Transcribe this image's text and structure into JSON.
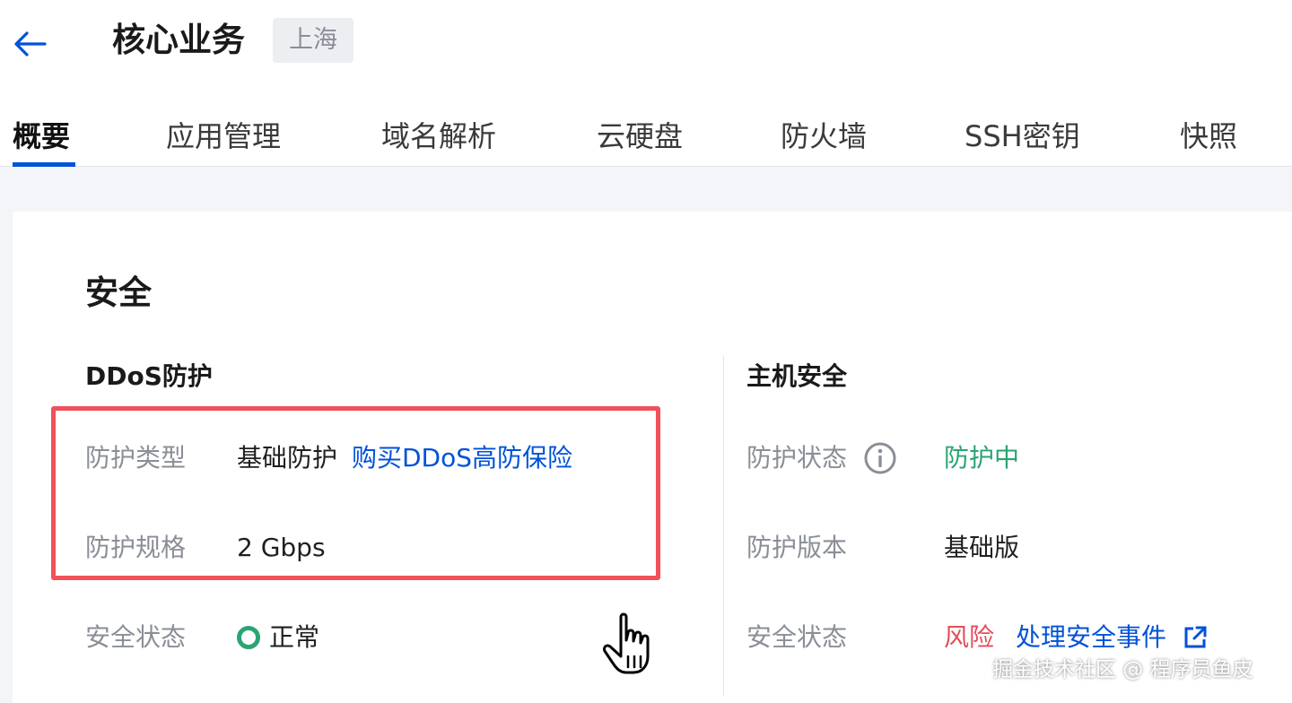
{
  "header": {
    "title": "核心业务",
    "region": "上海"
  },
  "tabs": [
    {
      "label": "概要",
      "active": true
    },
    {
      "label": "应用管理"
    },
    {
      "label": "域名解析"
    },
    {
      "label": "云硬盘"
    },
    {
      "label": "防火墙"
    },
    {
      "label": "SSH密钥"
    },
    {
      "label": "快照"
    }
  ],
  "security": {
    "title": "安全",
    "ddos": {
      "title": "DDoS防护",
      "type_label": "防护类型",
      "type_value": "基础防护",
      "buy_link": "购买DDoS高防保险",
      "spec_label": "防护规格",
      "spec_value": "2 Gbps",
      "status_label": "安全状态",
      "status_value": "正常"
    },
    "host": {
      "title": "主机安全",
      "status_label": "防护状态",
      "status_value": "防护中",
      "version_label": "防护版本",
      "version_value": "基础版",
      "safety_label": "安全状态",
      "safety_value": "风险",
      "handle_link": "处理安全事件"
    }
  },
  "colors": {
    "accent": "#0052d9",
    "success": "#2ba471",
    "danger": "#e34d59",
    "highlight": "#f0515b"
  },
  "watermark": "掘金技术社区 @ 程序员鱼皮"
}
